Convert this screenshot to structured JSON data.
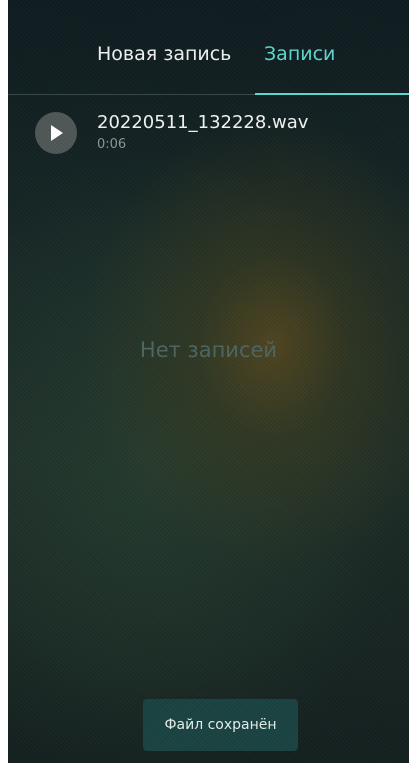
{
  "tabs": {
    "new_recording": "Новая запись",
    "records": "Записи",
    "active": "records"
  },
  "recordings": [
    {
      "name": "20220511_132228.wav",
      "duration": "0:06",
      "icon": "play-icon"
    }
  ],
  "empty_state": "Нет записей",
  "toast": "Файл сохранён",
  "colors": {
    "accent": "#5ed8cf",
    "toast_bg": "#1a4341",
    "play_button_bg": "#4f5757"
  }
}
